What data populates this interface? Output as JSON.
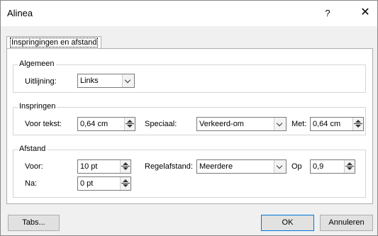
{
  "window": {
    "title": "Alinea",
    "help_label": "?",
    "close_label": "✕"
  },
  "tabs": [
    {
      "label": "Inspringingen en afstand"
    }
  ],
  "general": {
    "legend": "Algemeen",
    "alignment_label": "Uitlijning:",
    "alignment_value": "Links"
  },
  "indent": {
    "legend": "Inspringen",
    "before_text_label": "Voor tekst:",
    "before_text_value": "0,64 cm",
    "special_label": "Speciaal:",
    "special_value": "Verkeerd-om",
    "by_label": "Met:",
    "by_value": "0,64 cm"
  },
  "spacing": {
    "legend": "Afstand",
    "before_label": "Voor:",
    "before_value": "10 pt",
    "after_label": "Na:",
    "after_value": "0 pt",
    "line_spacing_label": "Regelafstand:",
    "line_spacing_value": "Meerdere",
    "at_label": "Op",
    "at_value": "0,9"
  },
  "buttons": {
    "tabs": "Tabs...",
    "ok": "OK",
    "cancel": "Annuleren"
  }
}
